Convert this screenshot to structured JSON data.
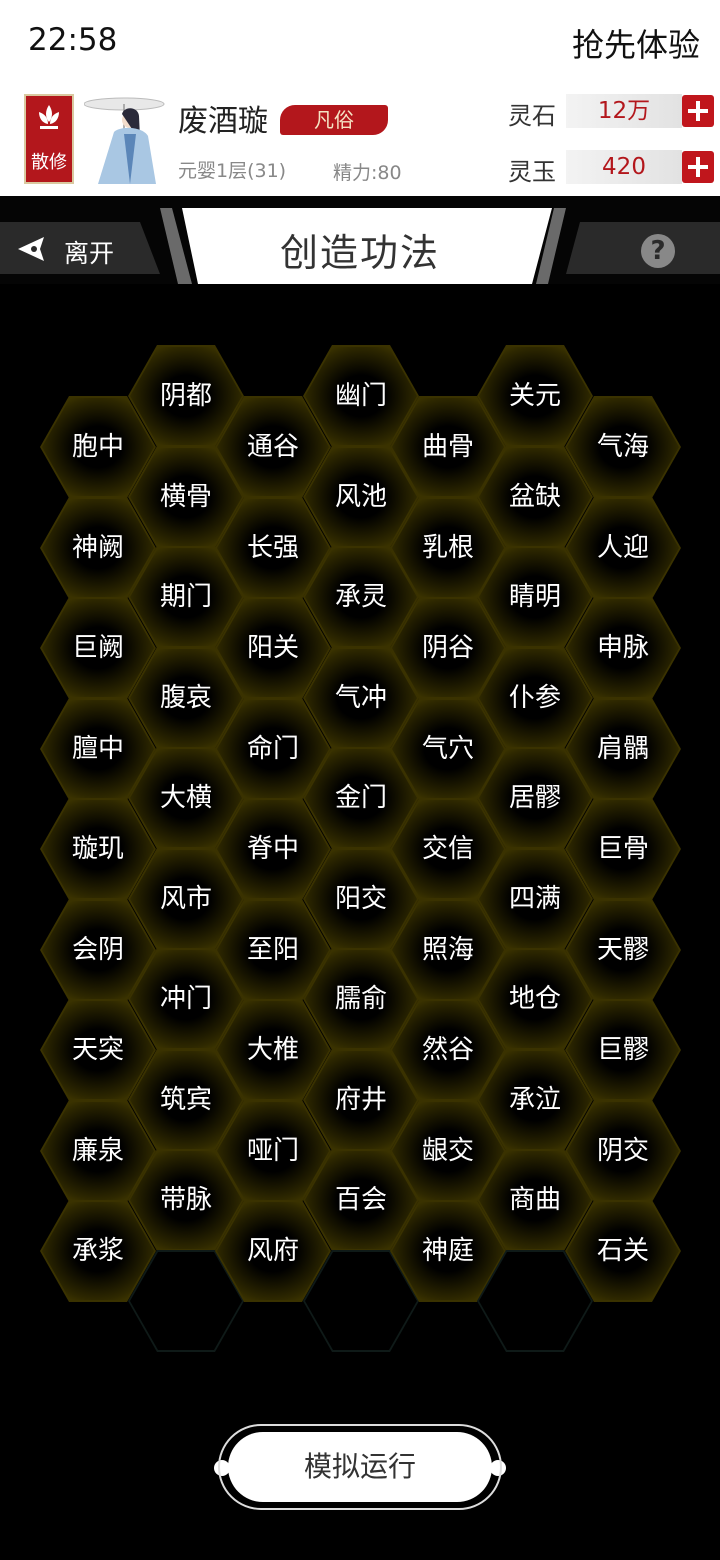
{
  "status": {
    "time": "22:58",
    "right_text": "抢先体验"
  },
  "profile": {
    "sect_label": "散修",
    "name": "废酒璇",
    "rank": "凡俗",
    "realm": "元婴1层(31)",
    "energy": "精力:80",
    "currencies": [
      {
        "label": "灵石",
        "value": "12万"
      },
      {
        "label": "灵玉",
        "value": "420"
      }
    ]
  },
  "nav": {
    "leave_label": "离开",
    "title": "创造功法",
    "help_symbol": "?"
  },
  "grid": {
    "columns": [
      [
        "胞中",
        "神阙",
        "巨阙",
        "膻中",
        "璇玑",
        "会阴",
        "天突",
        "廉泉",
        "承浆"
      ],
      [
        "阴都",
        "横骨",
        "期门",
        "腹哀",
        "大横",
        "风市",
        "冲门",
        "筑宾",
        "带脉",
        ""
      ],
      [
        "通谷",
        "长强",
        "阳关",
        "命门",
        "脊中",
        "至阳",
        "大椎",
        "哑门",
        "风府"
      ],
      [
        "幽门",
        "风池",
        "承灵",
        "气冲",
        "金门",
        "阳交",
        "臑俞",
        "府井",
        "百会",
        ""
      ],
      [
        "曲骨",
        "乳根",
        "阴谷",
        "气穴",
        "交信",
        "照海",
        "然谷",
        "龈交",
        "神庭"
      ],
      [
        "关元",
        "盆缺",
        "睛明",
        "仆参",
        "居髎",
        "四满",
        "地仓",
        "承泣",
        "商曲",
        ""
      ],
      [
        "气海",
        "人迎",
        "申脉",
        "肩髃",
        "巨骨",
        "天髎",
        "巨髎",
        "阴交",
        "石关"
      ]
    ]
  },
  "action": {
    "simulate_label": "模拟运行"
  },
  "colors": {
    "accent": "#b3171c",
    "hex_glow": "#5a4e00"
  }
}
